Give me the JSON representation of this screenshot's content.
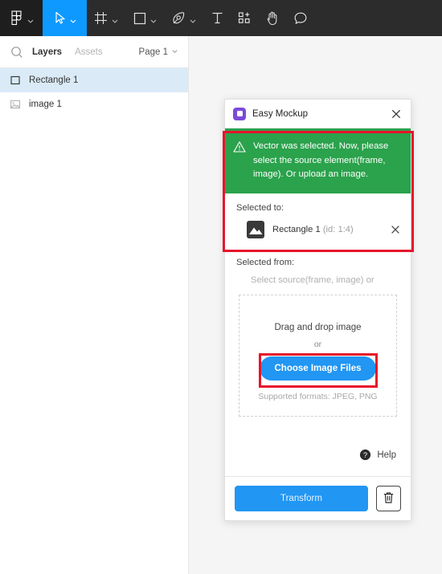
{
  "toolbar": {
    "items": [
      {
        "name": "figma-logo-icon",
        "label": "Figma",
        "caret": true,
        "active": false,
        "dark": true
      },
      {
        "name": "move-tool-icon",
        "label": "Move",
        "caret": true,
        "active": true,
        "dark": false
      },
      {
        "name": "frame-tool-icon",
        "label": "Frame",
        "caret": true,
        "active": false,
        "dark": false
      },
      {
        "name": "shape-tool-icon",
        "label": "Rectangle",
        "caret": true,
        "active": false,
        "dark": false
      },
      {
        "name": "pen-tool-icon",
        "label": "Pen",
        "caret": true,
        "active": false,
        "dark": false
      },
      {
        "name": "text-tool-icon",
        "label": "Text",
        "caret": false,
        "active": false,
        "dark": false
      },
      {
        "name": "components-tool-icon",
        "label": "Components",
        "caret": false,
        "active": false,
        "dark": false
      },
      {
        "name": "hand-tool-icon",
        "label": "Hand",
        "caret": false,
        "active": false,
        "dark": false
      },
      {
        "name": "comment-tool-icon",
        "label": "Comment",
        "caret": false,
        "active": false,
        "dark": false
      }
    ]
  },
  "sidebar": {
    "tabs": [
      {
        "label": "Layers",
        "selected": true
      },
      {
        "label": "Assets",
        "selected": false
      }
    ],
    "page_selector": "Page 1",
    "layers": [
      {
        "label": "Rectangle 1",
        "icon": "rectangle-layer-icon",
        "selected": true
      },
      {
        "label": "image 1",
        "icon": "image-layer-icon",
        "selected": false
      }
    ]
  },
  "dialog": {
    "title": "Easy Mockup",
    "close_label": "Close",
    "alert": {
      "text": "Vector was selected. Now, please select the source element(frame, image). Or upload an image.",
      "color": "#2ba24c"
    },
    "selected_to": {
      "label": "Selected to:",
      "item_name": "Rectangle 1",
      "item_id": "(id: 1:4)"
    },
    "selected_from": {
      "label": "Selected from:",
      "hint": "Select source(frame, image) or",
      "dropzone_title": "Drag and drop image",
      "dropzone_or": "or",
      "choose_button": "Choose Image Files",
      "supported_formats": "Supported formats: JPEG, PNG"
    },
    "help_label": "Help",
    "footer": {
      "transform_label": "Transform",
      "delete_label": "Delete"
    },
    "accent_color": "#2196f3"
  },
  "annotations": {
    "highlight_color": "#e8132b",
    "boxes": [
      {
        "name": "alert-and-selection-highlight"
      },
      {
        "name": "choose-image-files-highlight"
      }
    ]
  }
}
